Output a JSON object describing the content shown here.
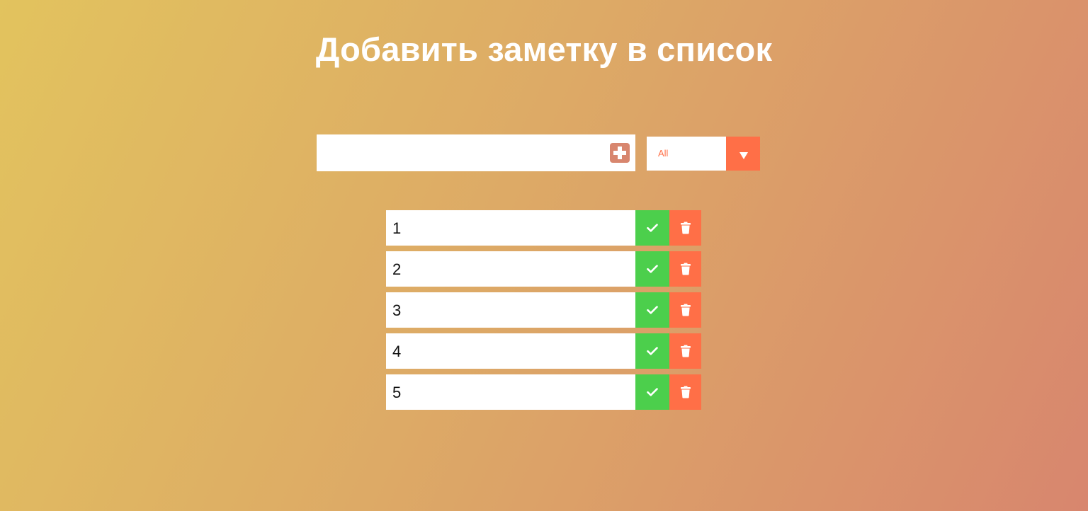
{
  "header": {
    "title": "Добавить заметку в список"
  },
  "form": {
    "input_value": "",
    "input_placeholder": "",
    "add_icon": "plus-square-icon",
    "filter_selected": "All",
    "filter_arrow_icon": "caret-down-icon"
  },
  "todos": [
    {
      "text": "1",
      "complete_icon": "check-icon",
      "delete_icon": "trash-icon"
    },
    {
      "text": "2",
      "complete_icon": "check-icon",
      "delete_icon": "trash-icon"
    },
    {
      "text": "3",
      "complete_icon": "check-icon",
      "delete_icon": "trash-icon"
    },
    {
      "text": "4",
      "complete_icon": "check-icon",
      "delete_icon": "trash-icon"
    },
    {
      "text": "5",
      "complete_icon": "check-icon",
      "delete_icon": "trash-icon"
    }
  ],
  "colors": {
    "gradient_start": "#e2c35e",
    "gradient_end": "#d8866e",
    "accent_orange": "#ff6f47",
    "complete_green": "#4ccf4c",
    "add_button": "#d8866e"
  }
}
